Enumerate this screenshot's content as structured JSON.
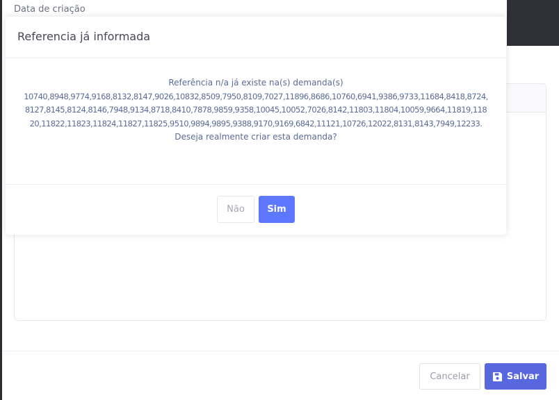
{
  "background_form": {
    "field_label": "Data de criação",
    "footer": {
      "cancel_label": "Cancelar",
      "save_label": "Salvar"
    }
  },
  "dialog": {
    "title": "Referencia já informada",
    "message_intro": "Referência n/a já existe na(s) demanda(s)",
    "message_refs": "10740,8948,9774,9168,8132,8147,9026,10832,8509,7950,8109,7027,11896,8686,10760,6941,9386,9733,11684,8418,8724,8127,8145,8124,8146,7948,9134,8718,8410,7878,9859,9358,10045,10052,7026,8142,11803,11804,10059,9664,11819,11820,11822,11823,11824,11827,11825,9510,9894,9895,9388,9170,9169,6842,11121,10726,12022,8131,8143,7949,12233.",
    "message_question": "Deseja realmente criar esta demanda?",
    "buttons": {
      "no_label": "Não",
      "yes_label": "Sim"
    }
  },
  "colors": {
    "primary": "#5867dd",
    "confirm": "#5d78ff",
    "message_text": "#5b6b99"
  }
}
